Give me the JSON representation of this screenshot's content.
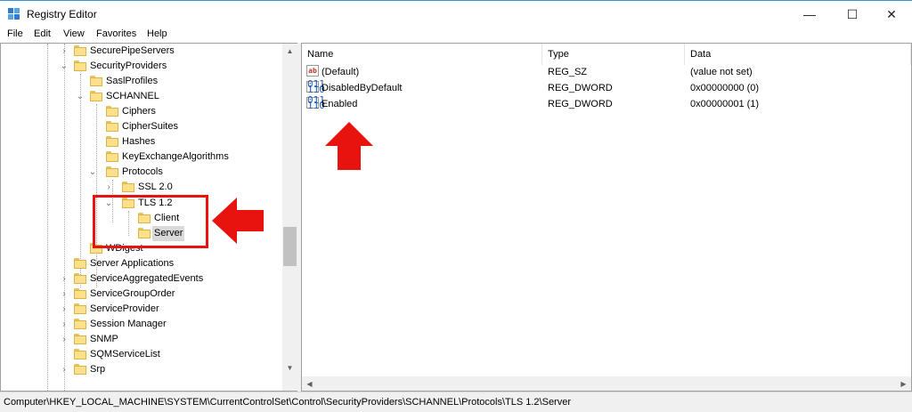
{
  "window": {
    "title": "Registry Editor",
    "minimize_glyph": "—",
    "maximize_glyph": "☐",
    "close_glyph": "✕"
  },
  "menu": [
    "File",
    "Edit",
    "View",
    "Favorites",
    "Help"
  ],
  "tree": {
    "items": [
      {
        "label": "SecurePipeServers"
      },
      {
        "label": "SecurityProviders"
      },
      {
        "label": "SaslProfiles"
      },
      {
        "label": "SCHANNEL"
      },
      {
        "label": "Ciphers"
      },
      {
        "label": "CipherSuites"
      },
      {
        "label": "Hashes"
      },
      {
        "label": "KeyExchangeAlgorithms"
      },
      {
        "label": "Protocols"
      },
      {
        "label": "SSL 2.0"
      },
      {
        "label": "TLS 1.2"
      },
      {
        "label": "Client"
      },
      {
        "label": "Server"
      },
      {
        "label": "WDigest"
      },
      {
        "label": "Server Applications"
      },
      {
        "label": "ServiceAggregatedEvents"
      },
      {
        "label": "ServiceGroupOrder"
      },
      {
        "label": "ServiceProvider"
      },
      {
        "label": "Session Manager"
      },
      {
        "label": "SNMP"
      },
      {
        "label": "SQMServiceList"
      },
      {
        "label": "Srp"
      }
    ]
  },
  "columns": {
    "name": "Name",
    "type": "Type",
    "data": "Data"
  },
  "values": [
    {
      "name": "(Default)",
      "type": "REG_SZ",
      "data": "(value not set)",
      "icon": "string-value-icon"
    },
    {
      "name": "DisabledByDefault",
      "type": "REG_DWORD",
      "data": "0x00000000 (0)",
      "icon": "dword-value-icon"
    },
    {
      "name": "Enabled",
      "type": "REG_DWORD",
      "data": "0x00000001 (1)",
      "icon": "dword-value-icon"
    }
  ],
  "icon_glyphs": {
    "string": "ab",
    "dword": "011\n110"
  },
  "status": {
    "path": "Computer\\HKEY_LOCAL_MACHINE\\SYSTEM\\CurrentControlSet\\Control\\SecurityProviders\\SCHANNEL\\Protocols\\TLS 1.2\\Server"
  },
  "colors": {
    "highlight": "#e8130f",
    "folder": "#ffe08a",
    "selection": "#d9d9d9"
  }
}
